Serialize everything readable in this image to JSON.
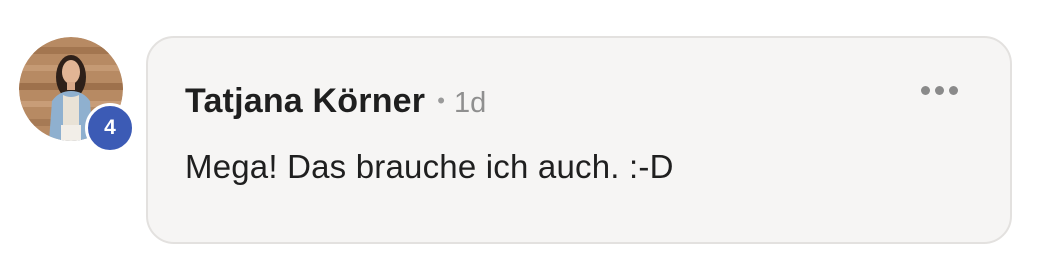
{
  "comment": {
    "author": "Tatjana Körner",
    "separator": "•",
    "time": "1d",
    "text": "Mega! Das brauche ich auch. :-D",
    "badge_count": "4"
  },
  "colors": {
    "badge": "#3c5bb5",
    "bubble_background": "#f6f5f4",
    "bubble_border": "#e3e1df",
    "text_primary": "#1f1f1f",
    "text_secondary": "#8f8f8f"
  },
  "icons": {
    "more_menu": "more-horizontal-icon"
  }
}
